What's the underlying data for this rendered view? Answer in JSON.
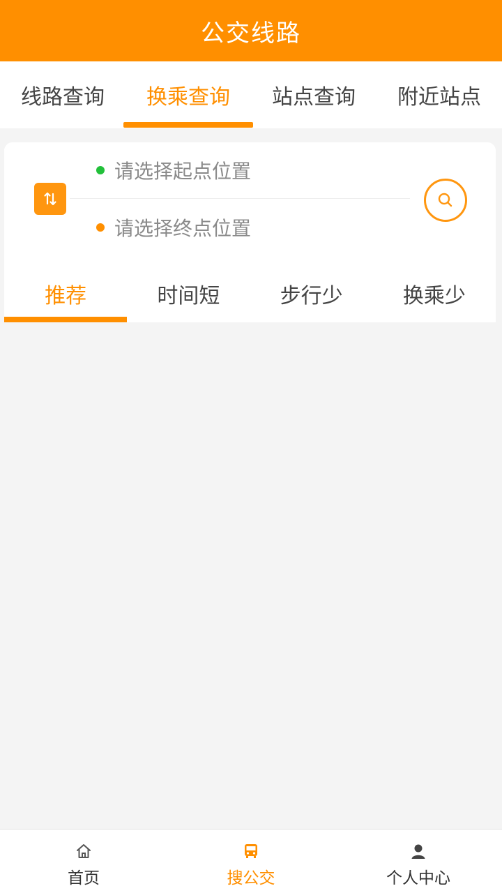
{
  "colors": {
    "brand": "#ff8f00",
    "start_dot": "#22c03a",
    "end_dot": "#ff8f00"
  },
  "header": {
    "title": "公交线路"
  },
  "top_tabs": [
    {
      "label": "线路查询",
      "active": false
    },
    {
      "label": "换乘查询",
      "active": true
    },
    {
      "label": "站点查询",
      "active": false
    },
    {
      "label": "附近站点",
      "active": false
    }
  ],
  "route": {
    "swap_icon": "swap-vertical-icon",
    "start_placeholder": "请选择起点位置",
    "end_placeholder": "请选择终点位置",
    "search_icon": "search-icon"
  },
  "sort_tabs": [
    {
      "label": "推荐",
      "active": true
    },
    {
      "label": "时间短",
      "active": false
    },
    {
      "label": "步行少",
      "active": false
    },
    {
      "label": "换乘少",
      "active": false
    }
  ],
  "bottom_nav": [
    {
      "label": "首页",
      "icon": "home-icon",
      "active": false
    },
    {
      "label": "搜公交",
      "icon": "bus-icon",
      "active": true
    },
    {
      "label": "个人中心",
      "icon": "user-icon",
      "active": false
    }
  ]
}
